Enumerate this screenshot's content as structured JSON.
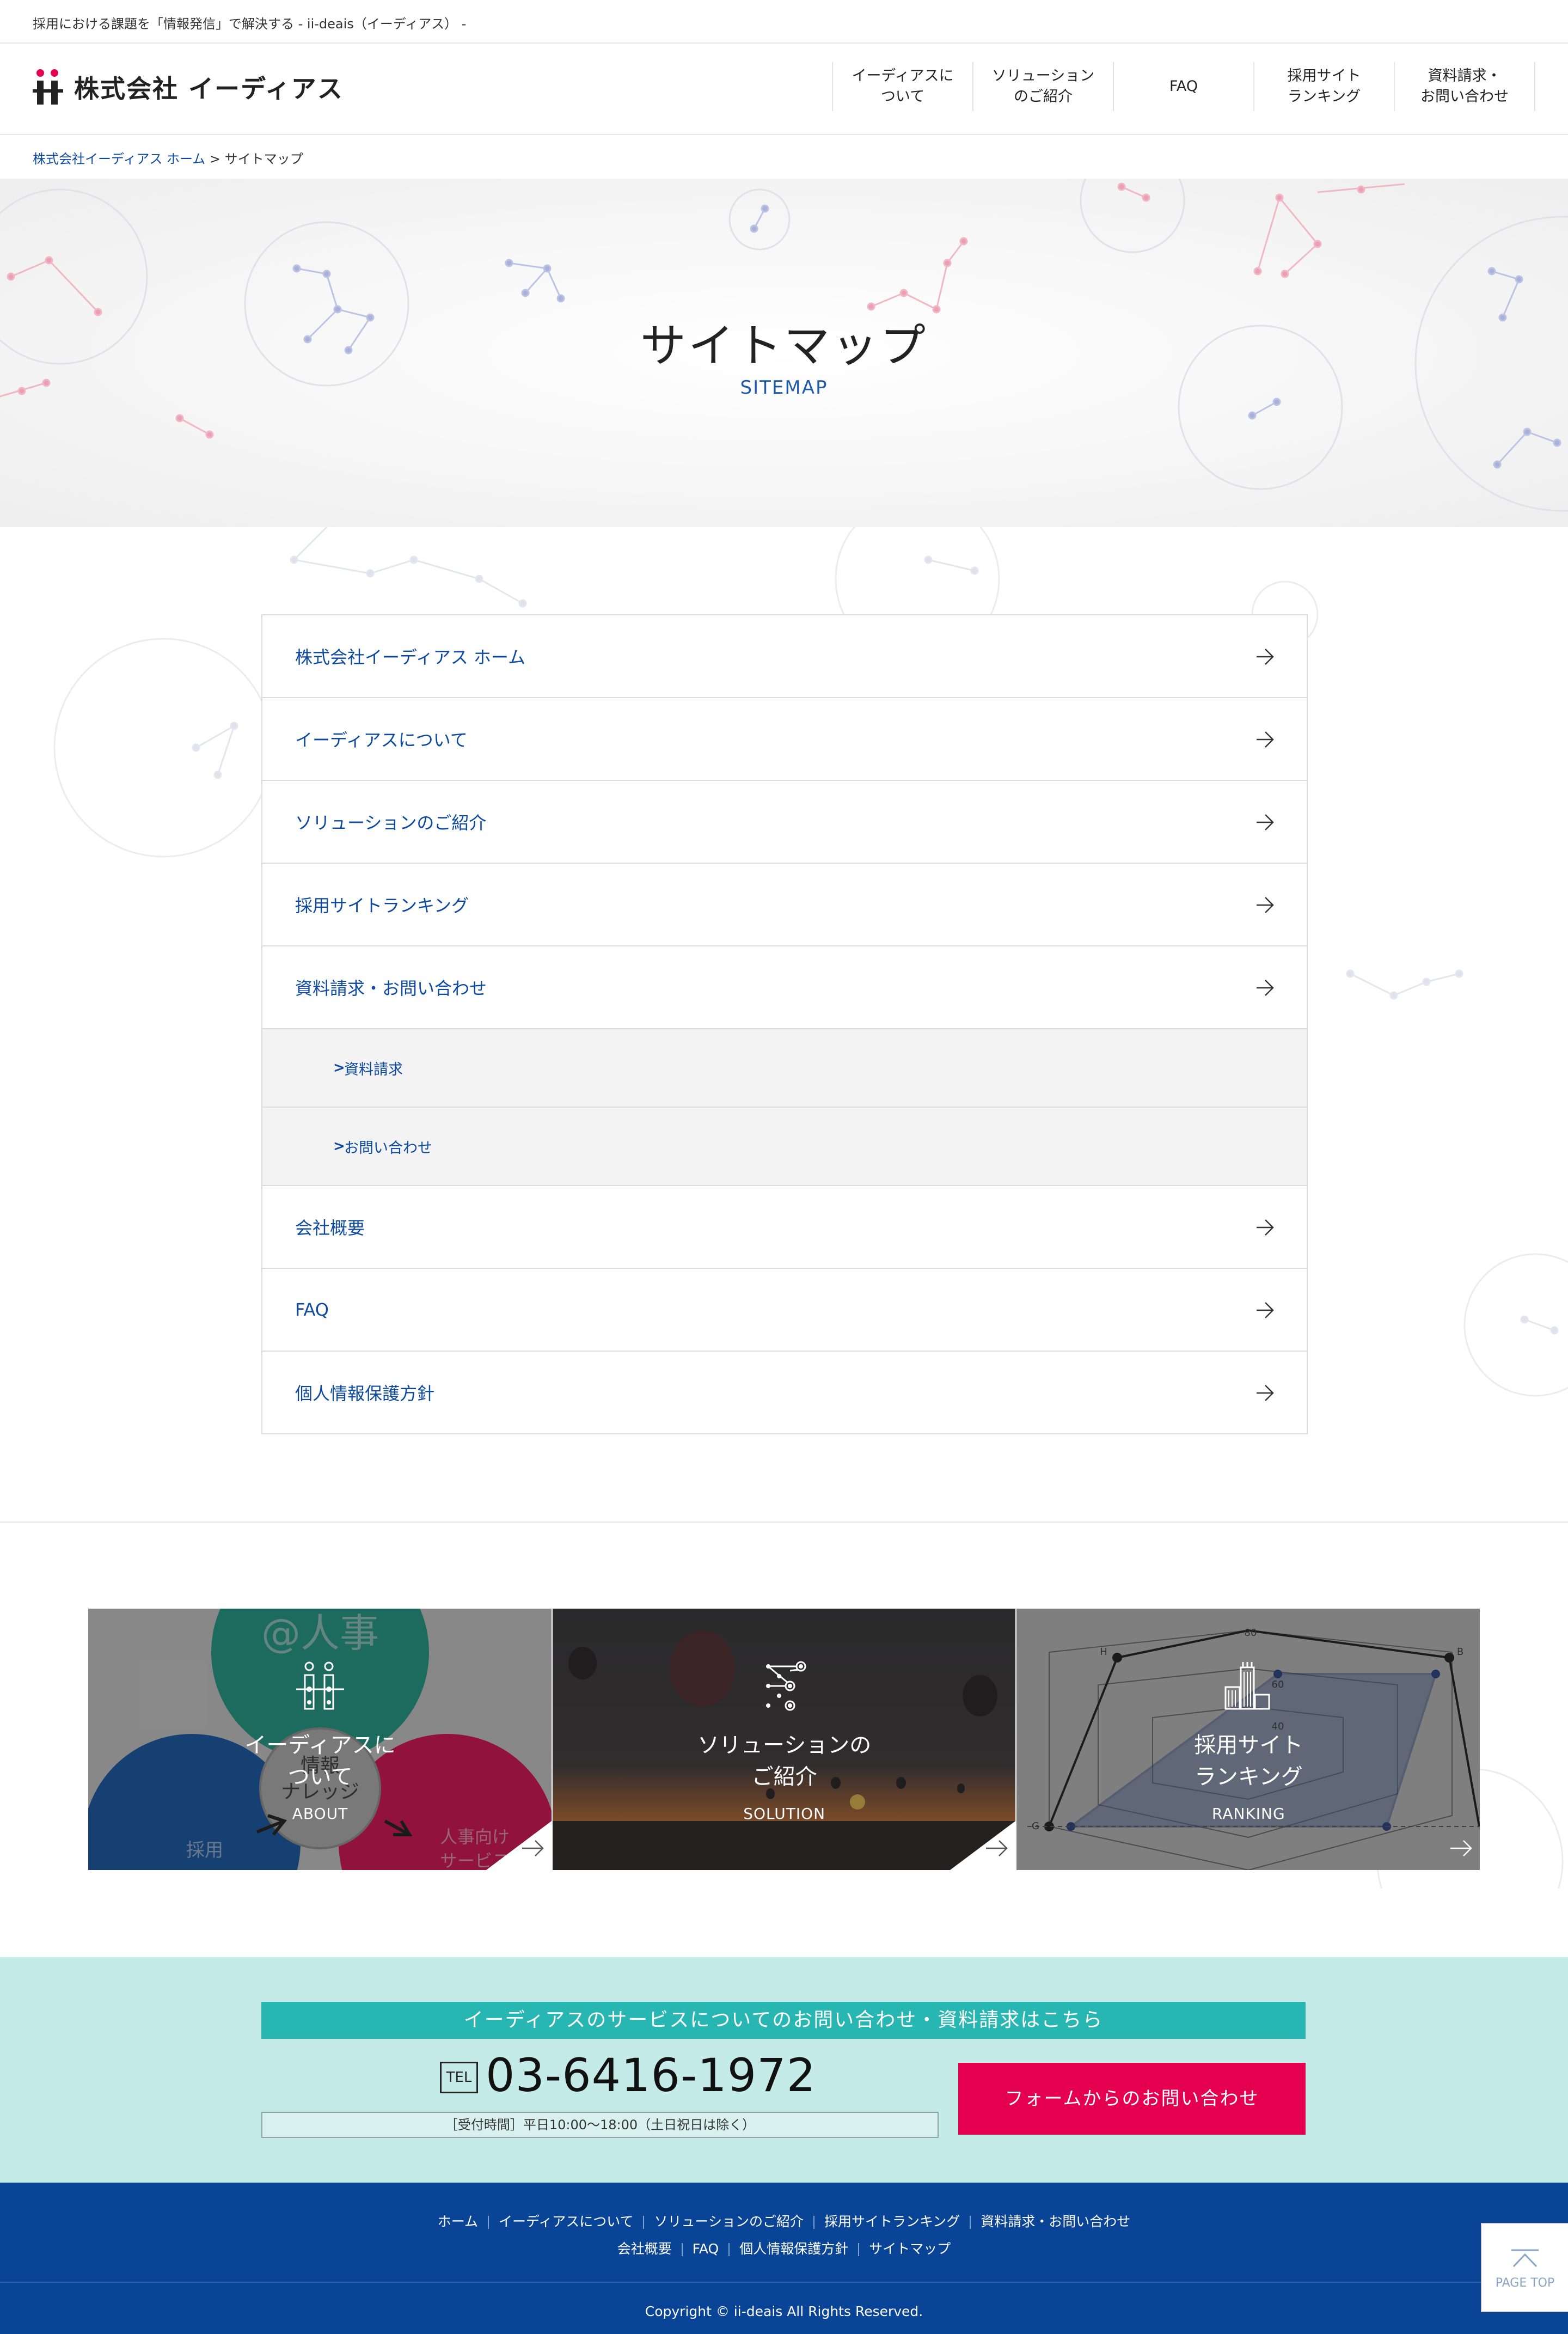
{
  "topbar": {
    "tagline": "採用における課題を「情報発信」で解決する - ii-deais（イーディアス） -"
  },
  "header": {
    "logo_text": "株式会社 イーディアス",
    "nav": [
      {
        "label": "イーディアスに\nついて"
      },
      {
        "label": "ソリューション\nのご紹介"
      },
      {
        "label": "FAQ"
      },
      {
        "label": "採用サイト\nランキング"
      },
      {
        "label": "資料請求・\nお問い合わせ"
      }
    ]
  },
  "breadcrumb": {
    "home": "株式会社イーディアス ホーム",
    "sep": ">",
    "current": "サイトマップ"
  },
  "hero": {
    "title": "サイトマップ",
    "subtitle": "SITEMAP"
  },
  "sitemap": {
    "items": [
      {
        "label": "株式会社イーディアス ホーム"
      },
      {
        "label": "イーディアスについて"
      },
      {
        "label": "ソリューションのご紹介"
      },
      {
        "label": "採用サイトランキング"
      },
      {
        "label": "資料請求・お問い合わせ"
      }
    ],
    "subitems": [
      {
        "mark": ">",
        "label": "資料請求"
      },
      {
        "mark": ">",
        "label": "お問い合わせ"
      }
    ],
    "items2": [
      {
        "label": "会社概要"
      },
      {
        "label": "FAQ"
      },
      {
        "label": "個人情報保護方針"
      }
    ]
  },
  "cards": [
    {
      "title": "イーディアスに\nついて",
      "subtitle": "ABOUT",
      "bg_texts": [
        "@人事",
        "情報\nナレッジ",
        "採用",
        "人事向け\nサービス"
      ]
    },
    {
      "title": "ソリューションの\nご紹介",
      "subtitle": "SOLUTION"
    },
    {
      "title": "採用サイト\nランキング",
      "subtitle": "RANKING",
      "bg_texts": [
        "80",
        "60",
        "40",
        "H",
        "B",
        "G"
      ]
    }
  ],
  "contact": {
    "heading": "イーディアスのサービスについてのお問い合わせ・資料請求はこちら",
    "tel_badge": "TEL",
    "tel": "03-6416-1972",
    "hours": "［受付時間］平日10:00〜18:00（土日祝日は除く）",
    "form_button": "フォームからのお問い合わせ"
  },
  "footer": {
    "nav1": [
      "ホーム",
      "イーディアスについて",
      "ソリューションのご紹介",
      "採用サイトランキング",
      "資料請求・お問い合わせ"
    ],
    "nav2": [
      "会社概要",
      "FAQ",
      "個人情報保護方針",
      "サイトマップ"
    ],
    "copyright": "Copyright © ii-deais All Rights Reserved."
  },
  "pagetop": {
    "label": "PAGE TOP"
  },
  "colors": {
    "link_blue": "#0d4aa0",
    "teal_band": "#c4ebe8",
    "teal_head": "#28b6b3",
    "cta_red": "#e5004f",
    "footer_blue": "#0a4497"
  },
  "icons": [
    "logo-ii-mark",
    "right-arrow-icon",
    "chevron-up-icon",
    "network-icon",
    "ranking-tower-icon"
  ]
}
